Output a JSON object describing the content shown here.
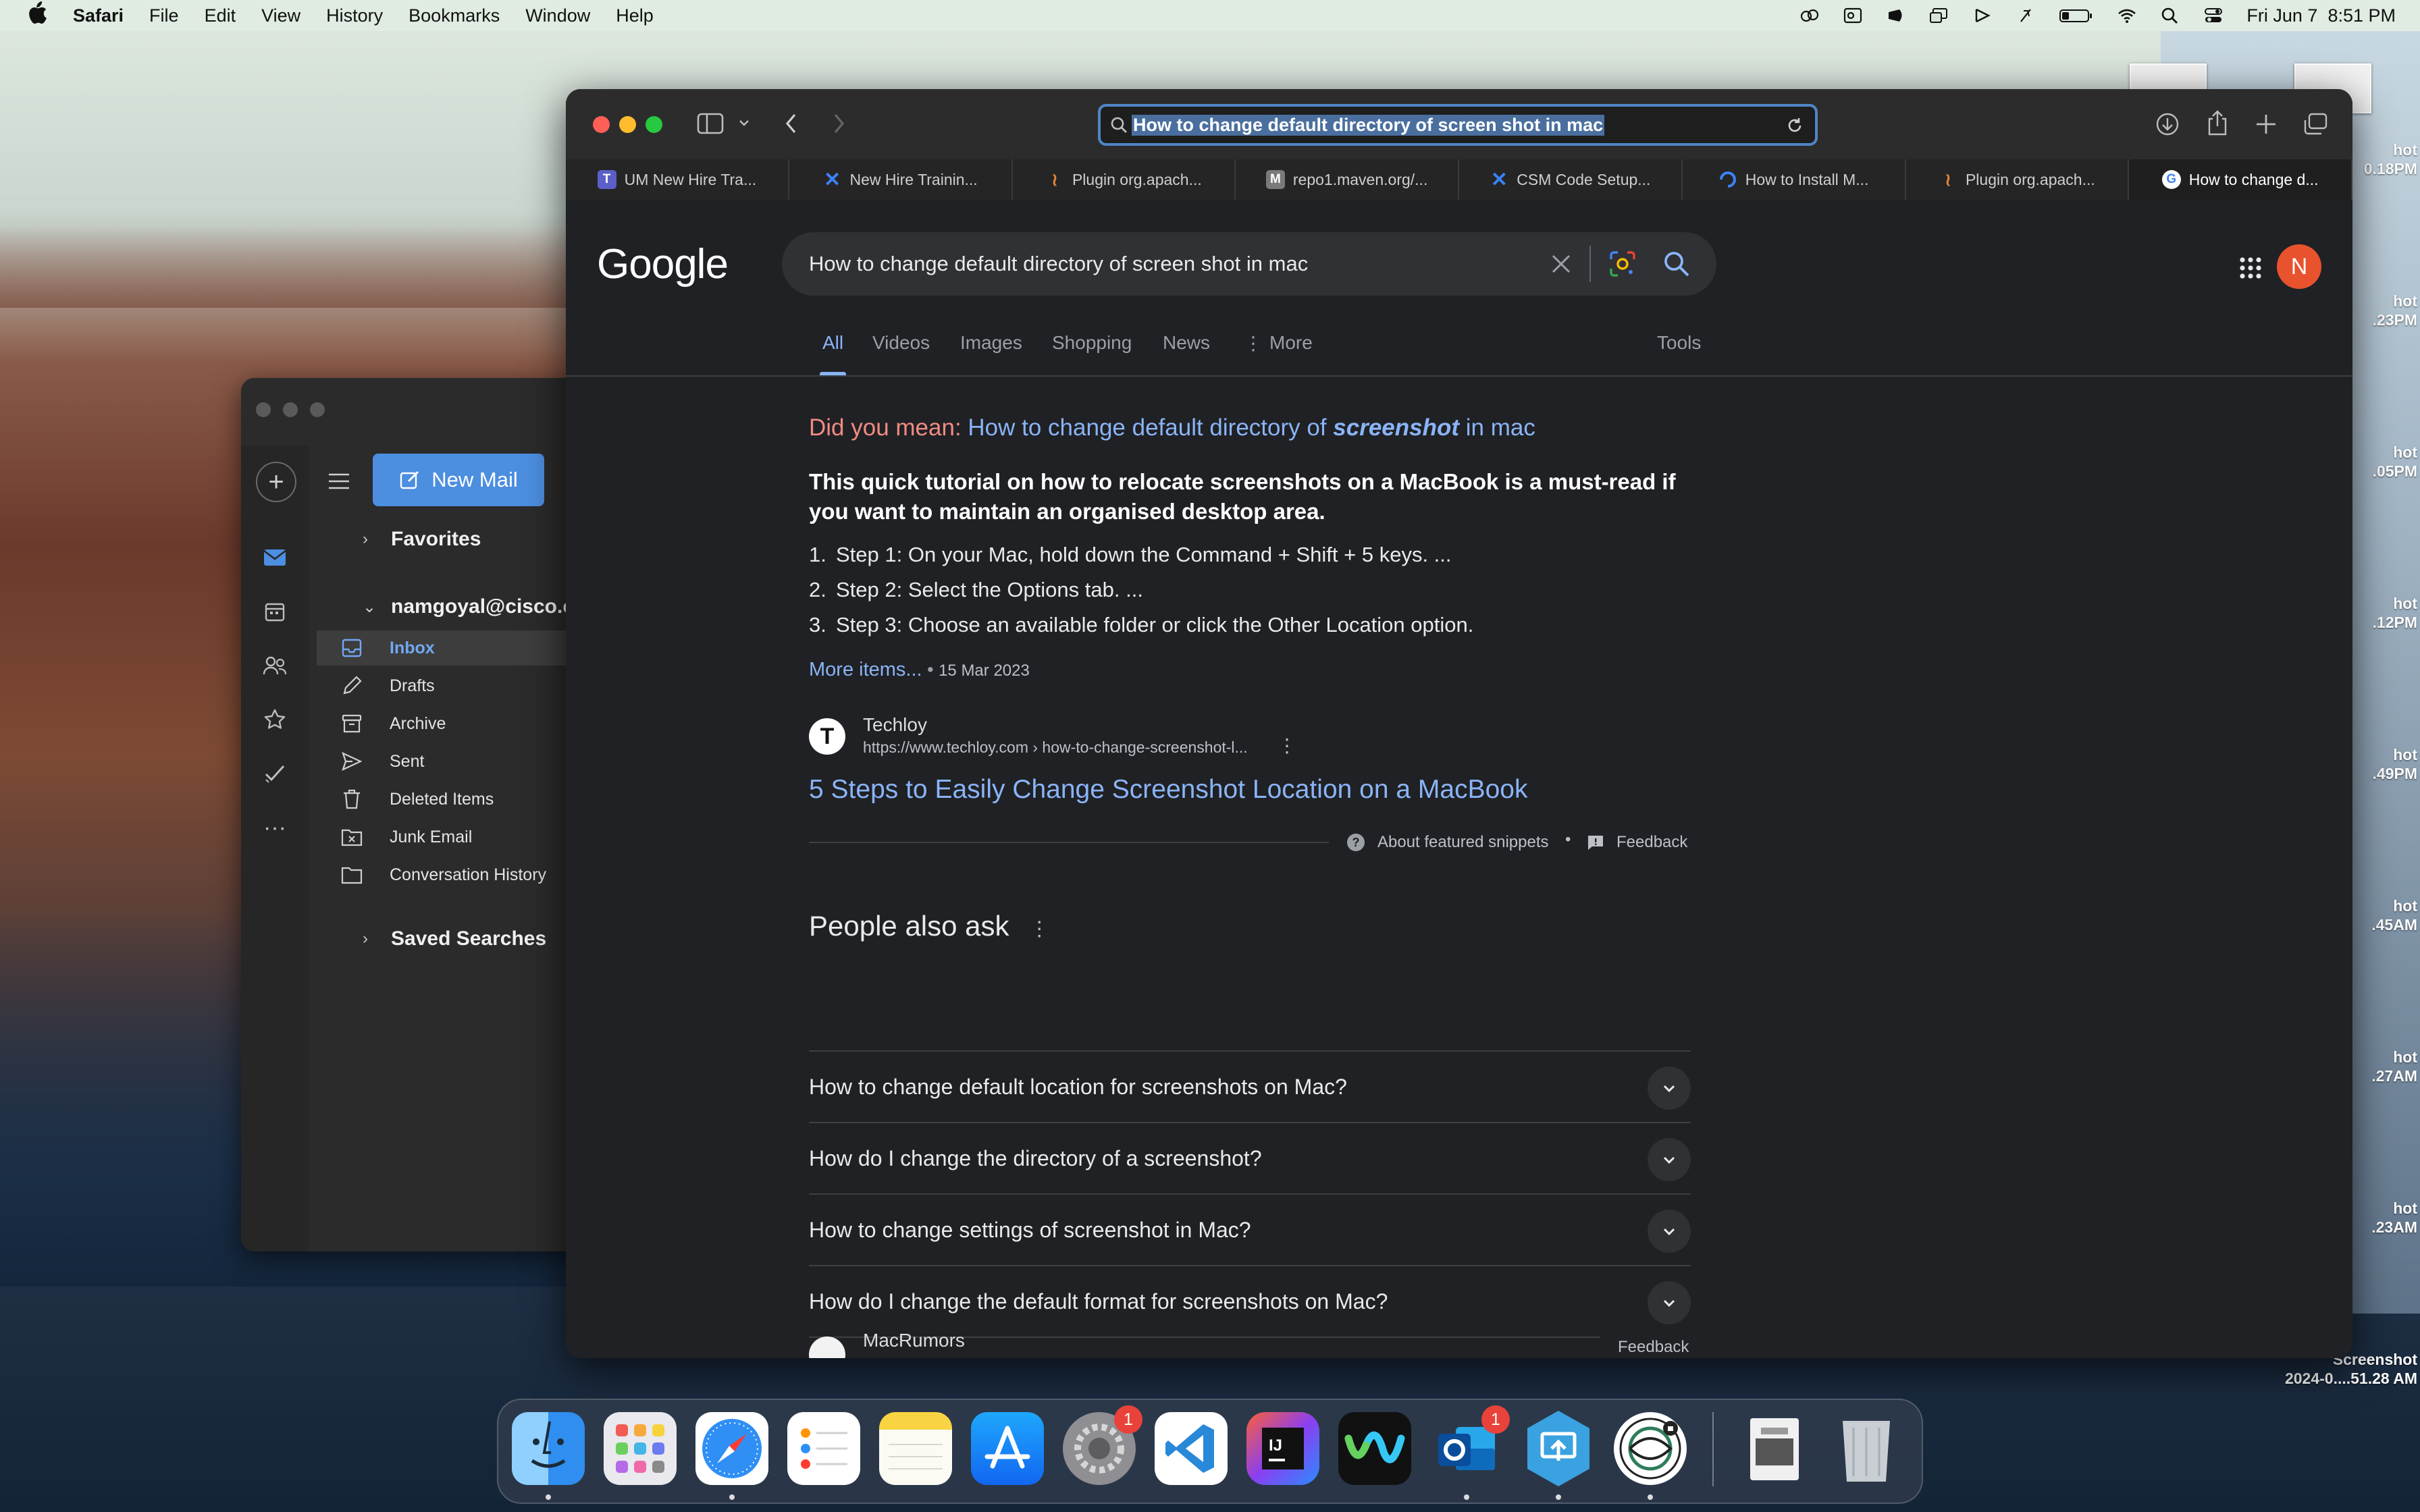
{
  "menubar": {
    "app": "Safari",
    "items": [
      "File",
      "Edit",
      "View",
      "History",
      "Bookmarks",
      "Window",
      "Help"
    ],
    "datetime": "Fri Jun 7  8:51 PM",
    "icons": [
      "creative-cloud-icon",
      "outlook-status-icon",
      "notion-icon",
      "screen-icon",
      "media-icon",
      "mute-icon",
      "battery-icon",
      "wifi-icon",
      "spotlight-icon",
      "control-center-icon"
    ]
  },
  "desktop": {
    "files": [
      {
        "line1": "hot",
        "line2": "0.18PM"
      },
      {
        "line1": "hot",
        "line2": ".23PM"
      },
      {
        "line1": "hot",
        "line2": ".05PM"
      },
      {
        "line1": "hot",
        "line2": ".12PM"
      },
      {
        "line1": "hot",
        "line2": ".49PM"
      },
      {
        "line1": "hot",
        "line2": ".45AM"
      },
      {
        "line1": "hot",
        "line2": ".27AM"
      },
      {
        "line1": "hot",
        "line2": ".23AM"
      },
      {
        "line1": "Screenshot",
        "line2": "2024-0....51.28 AM"
      }
    ]
  },
  "outlook": {
    "new_mail": "New Mail",
    "favorites": "Favorites",
    "account": "namgoyal@cisco.com",
    "folders": [
      "Inbox",
      "Drafts",
      "Archive",
      "Sent",
      "Deleted Items",
      "Junk Email",
      "Conversation History"
    ],
    "saved_searches": "Saved Searches"
  },
  "safari": {
    "address": "How to change default directory of screen shot in mac",
    "tabs": [
      {
        "label": "UM New Hire Tra...",
        "icon": "teams-icon",
        "color": "#5b5fc7",
        "glyph": "T"
      },
      {
        "label": "New Hire Trainin...",
        "icon": "confluence-icon",
        "color": "#1f6fd9",
        "glyph": "✕"
      },
      {
        "label": "Plugin org.apach...",
        "icon": "maven-feather-icon",
        "color": "#2a2a2a",
        "glyph": "≀"
      },
      {
        "label": "repo1.maven.org/...",
        "icon": "maven-m-icon",
        "color": "#6a6a6a",
        "glyph": "M"
      },
      {
        "label": "CSM Code Setup...",
        "icon": "confluence-icon",
        "color": "#1f6fd9",
        "glyph": "✕"
      },
      {
        "label": "How to Install M...",
        "icon": "digitalocean-icon",
        "color": "#2f6fe0",
        "glyph": "◌"
      },
      {
        "label": "Plugin org.apach...",
        "icon": "maven-feather-icon",
        "color": "#2a2a2a",
        "glyph": "≀"
      },
      {
        "label": "How to change d...",
        "icon": "google-icon",
        "color": "#ffffff",
        "glyph": "G"
      }
    ]
  },
  "google": {
    "logo": "Google",
    "query": "How to change default directory of screen shot in mac",
    "avatar_letter": "N",
    "tabs": [
      "All",
      "Videos",
      "Images",
      "Shopping",
      "News",
      "More"
    ],
    "tools": "Tools",
    "did_you_mean_prefix": "Did you mean:",
    "did_you_mean_before": "How to change default directory of",
    "did_you_mean_bold": "screenshot",
    "did_you_mean_after": "in mac",
    "snippet_heading": "This quick tutorial on how to relocate screenshots on a MacBook is a must-read if you want to maintain an organised desktop area.",
    "steps": [
      "Step 1: On your Mac, hold down the Command + Shift + 5 keys. ...",
      "Step 2: Select the Options tab. ...",
      "Step 3: Choose an available folder or click the Other Location option."
    ],
    "more_items": "More items...",
    "date": "15 Mar 2023",
    "source_name": "Techloy",
    "source_url": "https://www.techloy.com › how-to-change-screenshot-l...",
    "result_title": "5 Steps to Easily Change Screenshot Location on a MacBook",
    "about_snippets": "About featured snippets",
    "feedback": "Feedback",
    "paa_title": "People also ask",
    "paa": [
      "How to change default location for screenshots on Mac?",
      "How do I change the directory of a screenshot?",
      "How to change settings of screenshot in Mac?",
      "How do I change the default format for screenshots on Mac?"
    ],
    "paa_feedback": "Feedback",
    "next_source": "MacRumors"
  },
  "dock": {
    "apps": [
      {
        "name": "Finder",
        "badge": ""
      },
      {
        "name": "Launchpad",
        "badge": ""
      },
      {
        "name": "Safari",
        "badge": ""
      },
      {
        "name": "Reminders",
        "badge": ""
      },
      {
        "name": "Notes",
        "badge": ""
      },
      {
        "name": "App Store",
        "badge": ""
      },
      {
        "name": "System Settings",
        "badge": "1"
      },
      {
        "name": "Visual Studio Code",
        "badge": ""
      },
      {
        "name": "IntelliJ IDEA",
        "badge": ""
      },
      {
        "name": "Webex",
        "badge": ""
      },
      {
        "name": "Microsoft Outlook",
        "badge": "1"
      },
      {
        "name": "Screen Sharing",
        "badge": ""
      },
      {
        "name": "Cisco Secure Client",
        "badge": ""
      },
      {
        "name": "Preview",
        "badge": ""
      },
      {
        "name": "Trash",
        "badge": ""
      }
    ]
  },
  "colors": {
    "google_bg": "#202124",
    "link_blue": "#8ab4f8",
    "did_you_mean_red": "#f28b82",
    "outlook_accent": "#4c8ee0"
  }
}
